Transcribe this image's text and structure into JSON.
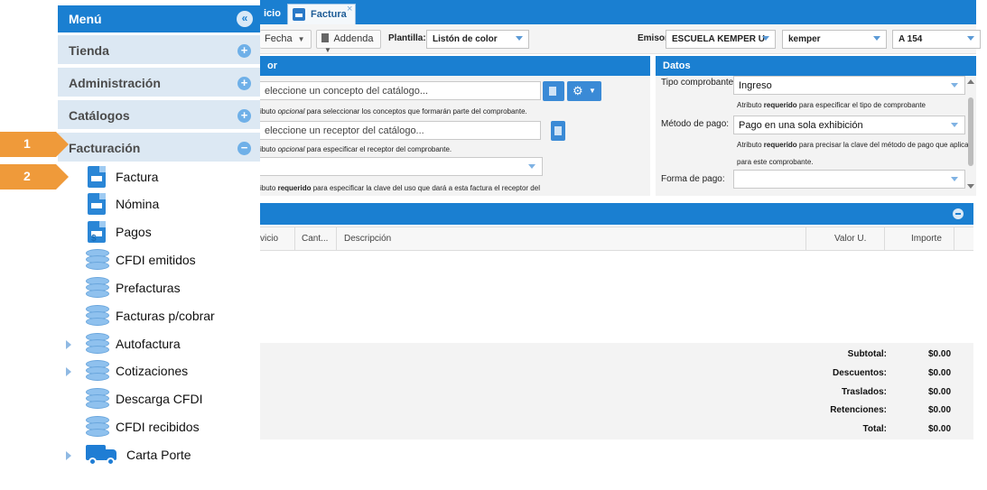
{
  "menu": {
    "title": "Menú",
    "collapse_icon": "«",
    "sections": [
      {
        "label": "Tienda",
        "toggle": "+"
      },
      {
        "label": "Administración",
        "toggle": "+"
      },
      {
        "label": "Catálogos",
        "toggle": "+"
      },
      {
        "label": "Facturación",
        "toggle": "−"
      }
    ],
    "items": [
      {
        "label": "Factura",
        "icon": "invoice-doc-icon"
      },
      {
        "label": "Nómina",
        "icon": "payroll-doc-icon"
      },
      {
        "label": "Pagos",
        "icon": "payment-doc-icon",
        "glyph": "$"
      },
      {
        "label": "CFDI emitidos",
        "icon": "database-icon"
      },
      {
        "label": "Prefacturas",
        "icon": "database-icon"
      },
      {
        "label": "Facturas p/cobrar",
        "icon": "database-icon"
      },
      {
        "label": "Autofactura",
        "icon": "database-icon"
      },
      {
        "label": "Cotizaciones",
        "icon": "database-icon"
      },
      {
        "label": "Descarga CFDI",
        "icon": "database-icon"
      },
      {
        "label": "CFDI recibidos",
        "icon": "database-icon"
      },
      {
        "label": "Carta Porte",
        "icon": "truck-icon"
      }
    ]
  },
  "callouts": [
    "1",
    "2"
  ],
  "tabs": {
    "previous": "icio",
    "active": "Factura",
    "close": "×"
  },
  "toolbar": {
    "fecha": "Fecha",
    "addenda": "Addenda",
    "plantilla_label": "Plantilla:",
    "plantilla_value": "Listón de color",
    "emisor_label": "Emisor",
    "emisor_value": "ESCUELA KEMPER U",
    "sucursal_value": "kemper",
    "serie_value": "A 154"
  },
  "left_panel": {
    "title": "or",
    "concept_placeholder": "eleccione un concepto del catálogo...",
    "concept_hint_pre": "ibuto ",
    "concept_hint_em": "opcional",
    "concept_hint_post": " para seleccionar los conceptos que formarán parte del comprobante.",
    "receptor_placeholder": "eleccione un receptor del catálogo...",
    "receptor_hint_pre": "ibuto ",
    "receptor_hint_em": "opcional",
    "receptor_hint_post": " para especificar el receptor del comprobante.",
    "uso_hint_pre": "ibuto ",
    "uso_hint_strong": "requerido",
    "uso_hint_post": " para especificar la clave del uso que dará a esta factura el receptor del"
  },
  "datos": {
    "title": "Datos",
    "tipo_label": "Tipo comprobante:",
    "tipo_value": "Ingreso",
    "tipo_hint_pre": "Atributo ",
    "tipo_hint_strong": "requerido",
    "tipo_hint_post": " para especificar el tipo de comprobante",
    "metodo_label": "Método de pago:",
    "metodo_value": "Pago en una sola exhibición",
    "metodo_hint_pre": "Atributo ",
    "metodo_hint_strong": "requerido",
    "metodo_hint_post": " para precisar la clave del método de pago que aplica",
    "metodo_hint_line2": "para este comprobante.",
    "forma_label": "Forma de pago:",
    "forma_value": ""
  },
  "grid": {
    "columns": [
      "vicio",
      "Cant...",
      "Descripción",
      "Valor U.",
      "Importe"
    ]
  },
  "totals": [
    {
      "label": "Subtotal:",
      "value": "$0.00"
    },
    {
      "label": "Descuentos:",
      "value": "$0.00"
    },
    {
      "label": "Traslados:",
      "value": "$0.00"
    },
    {
      "label": "Retenciones:",
      "value": "$0.00"
    },
    {
      "label": "Total:",
      "value": "$0.00"
    }
  ],
  "colors": {
    "accent": "#1a7fd1",
    "callout": "#ef9a3a",
    "menu_section": "#dce8f3"
  }
}
